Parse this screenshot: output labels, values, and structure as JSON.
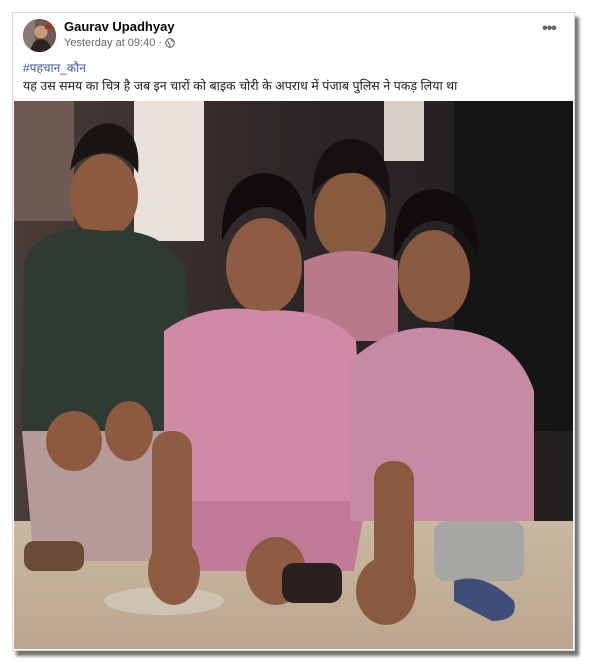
{
  "post": {
    "author": "Gaurav Upadhyay",
    "timestamp": "Yesterday at 09:40",
    "separator": "·",
    "privacy_icon": "globe-icon",
    "more_icon": "more-options-icon",
    "more_label": "•••",
    "hashtag": "#पहचान_कौन",
    "text": "यह उस समय का चित्र है जब इन चारों को बाइक चोरी के अपराध में पंजाब पुलिस ने पकड़ लिया था",
    "photo_icon": "photo"
  },
  "colors": {
    "link": "#385898",
    "meta": "#65676b",
    "text": "#1c1e21"
  }
}
